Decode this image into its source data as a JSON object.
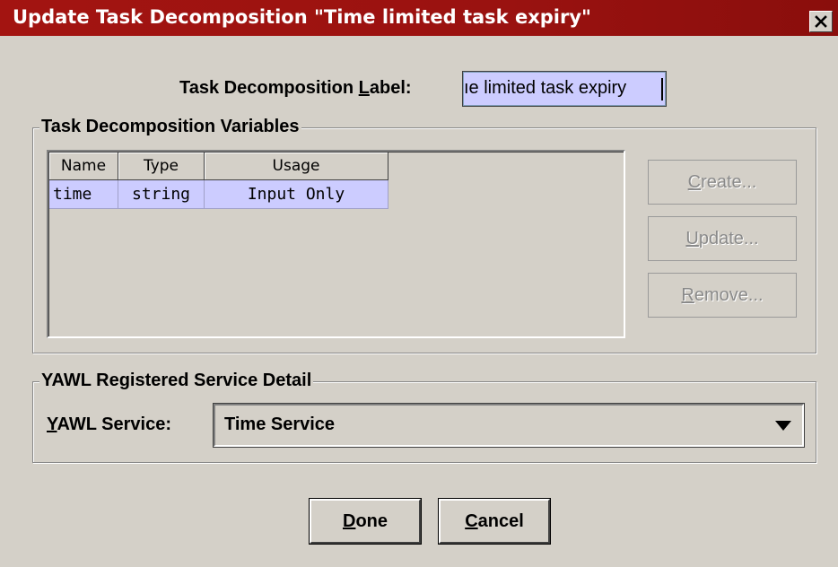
{
  "window": {
    "title": "Update Task Decomposition  \"Time limited task expiry\""
  },
  "label_field": {
    "label_before": "Task Decomposition ",
    "label_mnemonic": "L",
    "label_after": "abel:",
    "value": "Time limited task expiry",
    "visible_value": "ıe limited task expiry"
  },
  "variables_group": {
    "title": "Task Decomposition Variables",
    "columns": [
      "Name",
      "Type",
      "Usage"
    ],
    "rows": [
      {
        "name": "time",
        "type": "string",
        "usage": "Input Only"
      }
    ],
    "buttons": {
      "create": {
        "mnemonic": "C",
        "rest": "reate..."
      },
      "update": {
        "mnemonic": "U",
        "rest": "pdate..."
      },
      "remove": {
        "mnemonic": "R",
        "rest": "emove..."
      }
    }
  },
  "service_group": {
    "title": "YAWL Registered Service Detail",
    "label_mnemonic": "Y",
    "label_rest": "AWL Service:",
    "selected": "Time Service"
  },
  "footer": {
    "done": {
      "mnemonic": "D",
      "rest": "one"
    },
    "cancel": {
      "mnemonic": "C",
      "rest": "ancel"
    }
  },
  "colors": {
    "titlebar": "#a31411",
    "selection": "#ccccff",
    "face": "#d4d0c8"
  }
}
